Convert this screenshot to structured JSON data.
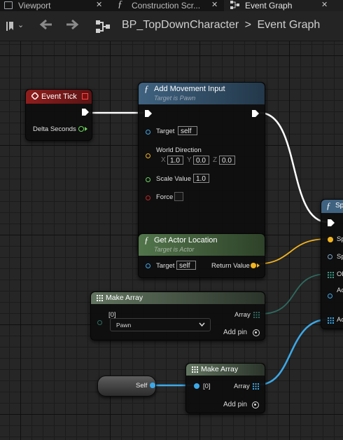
{
  "tabs": [
    {
      "label": "Viewport"
    },
    {
      "label": "Construction Scr..."
    },
    {
      "label": "Event Graph"
    }
  ],
  "breadcrumb": {
    "blueprint": "BP_TopDownCharacter",
    "separator": ">",
    "graph": "Event Graph"
  },
  "nodes": {
    "event_tick": {
      "title": "Event Tick",
      "delta_seconds": "Delta Seconds"
    },
    "add_movement_input": {
      "title": "Add Movement Input",
      "subtitle": "Target is Pawn",
      "target_label": "Target",
      "target_value": "self",
      "world_direction_label": "World Direction",
      "x_label": "X",
      "x_value": "1.0",
      "y_label": "Y",
      "y_value": "0.0",
      "z_label": "Z",
      "z_value": "0.0",
      "scale_label": "Scale Value",
      "scale_value": "1.0",
      "force_label": "Force",
      "force_checked": false
    },
    "get_actor_location": {
      "title": "Get Actor Location",
      "subtitle": "Target is Actor",
      "target_label": "Target",
      "target_value": "self",
      "return_label": "Return Value"
    },
    "make_array_1": {
      "title": "Make Array",
      "index_label": "[0]",
      "dropdown_value": "Pawn",
      "array_label": "Array",
      "add_pin": "Add pin"
    },
    "make_array_2": {
      "title": "Make Array",
      "index_label": "[0]",
      "array_label": "Array",
      "add_pin": "Add pin"
    },
    "self_ref": {
      "label": "Self"
    },
    "offscreen_function": {
      "title": "Sp",
      "pins": [
        "Sp",
        "Sp",
        "Ob",
        "Ac",
        "Ac"
      ]
    }
  },
  "colors": {
    "event_header": "#8f1d1d",
    "function_header": "#3f5f7a",
    "pure_header": "#4f6e48",
    "array_header": "#5d6e5a",
    "exec_wire": "#ffffff",
    "object_pin": "#3ca9e8",
    "vector_pin": "#f2b420",
    "float_pin": "#6cd35f",
    "bool_pin": "#a01e1e",
    "class_pin": "#2f6a5e"
  }
}
